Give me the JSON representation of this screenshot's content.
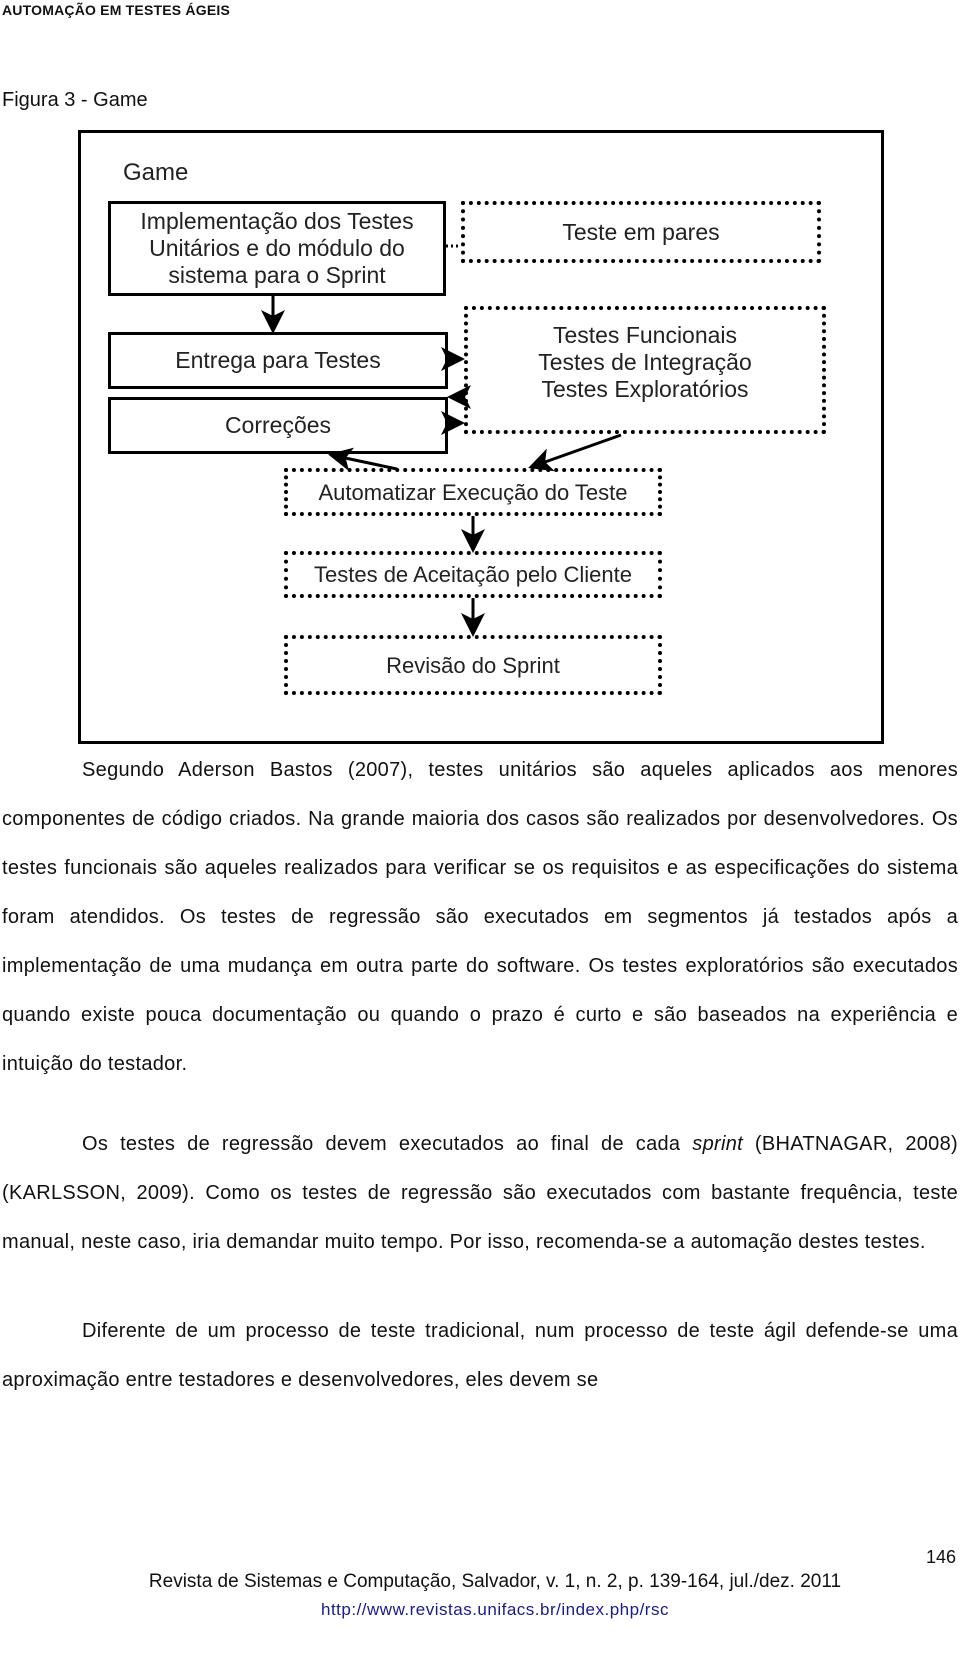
{
  "header": {
    "running_title": "AUTOMAÇÃO EM TESTES ÁGEIS"
  },
  "figure": {
    "caption": "Figura 3 - Game",
    "diagram_title": "Game",
    "nodes": [
      {
        "id": "impl",
        "label": "Implementação dos Testes Unitários e do módulo do sistema para o Sprint",
        "style": "solid"
      },
      {
        "id": "pares",
        "label": "Teste em pares",
        "style": "dotted"
      },
      {
        "id": "entrega",
        "label": "Entrega para Testes",
        "style": "solid"
      },
      {
        "id": "funcionais",
        "label": "Testes Funcionais\nTestes de Integração\nTestes Exploratórios",
        "style": "dotted"
      },
      {
        "id": "correcoes",
        "label": "Correções",
        "style": "solid"
      },
      {
        "id": "automatizar",
        "label": "Automatizar Execução do Teste",
        "style": "dotted"
      },
      {
        "id": "aceitacao",
        "label": "Testes de Aceitação pelo Cliente",
        "style": "dotted"
      },
      {
        "id": "revisao",
        "label": "Revisão do Sprint",
        "style": "dotted"
      }
    ],
    "edges": [
      {
        "from": "impl",
        "to": "pares",
        "style": "dotted"
      },
      {
        "from": "impl",
        "to": "entrega"
      },
      {
        "from": "entrega",
        "to": "funcionais"
      },
      {
        "from": "funcionais",
        "to": "correcoes"
      },
      {
        "from": "correcoes",
        "to": "funcionais"
      },
      {
        "from": "automatizar",
        "to": "correcoes"
      },
      {
        "from": "funcionais",
        "to": "automatizar"
      },
      {
        "from": "automatizar",
        "to": "aceitacao"
      },
      {
        "from": "aceitacao",
        "to": "revisao"
      }
    ]
  },
  "body": {
    "paragraphs": [
      "Segundo Aderson Bastos (2007), testes unitários são aqueles aplicados aos menores componentes de código criados. Na grande maioria dos casos são realizados por desenvolvedores. Os testes funcionais são aqueles realizados para verificar se os requisitos e as especificações do sistema foram atendidos. Os testes de regressão são executados em segmentos já testados após a implementação de uma mudança em outra parte do software. Os testes exploratórios são executados quando existe pouca documentação ou quando o prazo é curto e são baseados na experiência e intuição do testador.",
      {
        "before_italic": "Os testes de regressão devem executados ao final de cada ",
        "italic": "sprint",
        "after_italic": " (BHATNAGAR, 2008) (KARLSSON, 2009). Como os testes de regressão são executados com bastante frequência, teste manual, neste caso, iria demandar muito tempo. Por isso, recomenda-se a automação destes testes."
      },
      "Diferente de um processo de teste tradicional, num processo de teste ágil defende-se uma aproximação entre testadores e desenvolvedores, eles devem se"
    ]
  },
  "footer": {
    "page_number": "146",
    "citation": "Revista de Sistemas e Computação, Salvador, v. 1, n. 2, p. 139-164, jul./dez. 2011",
    "url": "http://www.revistas.unifacs.br/index.php/rsc"
  }
}
